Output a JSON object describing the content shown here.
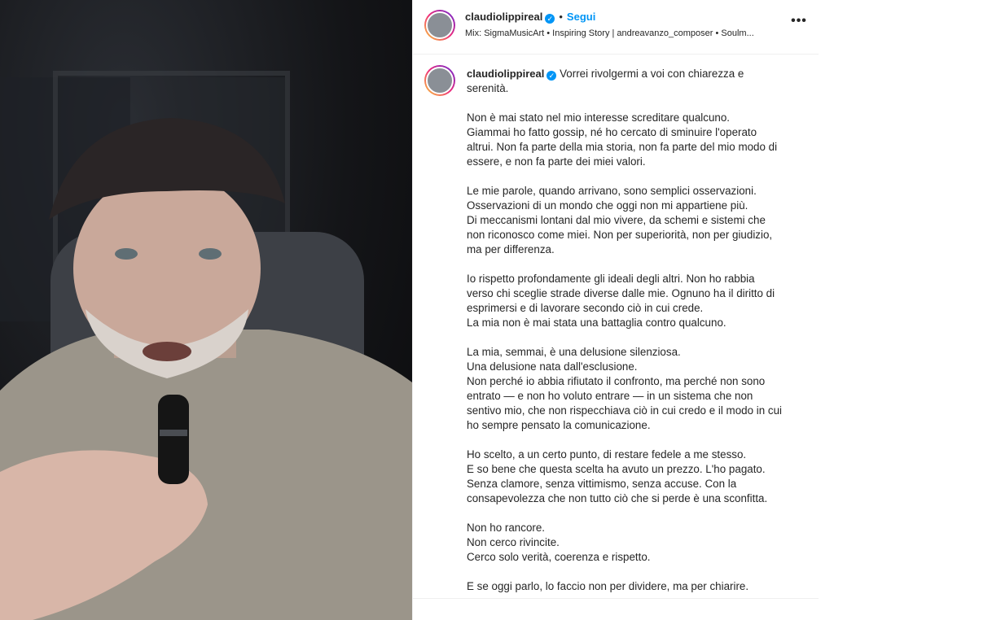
{
  "post": {
    "username": "claudiolippireal",
    "verified_mark": "✓",
    "separator": "•",
    "follow_label": "Segui",
    "audio": "Mix: SigmaMusicArt • Inspiring Story | andreavanzo_composer • Soulm...",
    "more_label": "•••"
  },
  "caption": {
    "username": "claudiolippireal",
    "first": "Vorrei rivolgermi a voi con chiarezza e serenità.",
    "paragraphs": [
      "Non è mai stato nel mio interesse screditare qualcuno.\nGiammai ho fatto gossip, né ho cercato di sminuire l'operato altrui. Non fa parte della mia storia, non fa parte del mio modo di essere, e non fa parte dei miei valori.",
      "Le mie parole, quando arrivano, sono semplici osservazioni.\nOsservazioni di un mondo che oggi non mi appartiene più.\nDi meccanismi lontani dal mio vivere, da schemi e sistemi che non riconosco come miei. Non per superiorità, non per giudizio, ma per differenza.",
      "Io rispetto profondamente gli ideali degli altri. Non ho rabbia verso chi sceglie strade diverse dalle mie. Ognuno ha il diritto di esprimersi e di lavorare secondo ciò in cui crede.\nLa mia non è mai stata una battaglia contro qualcuno.",
      "La mia, semmai, è una delusione silenziosa.\nUna delusione nata dall'esclusione.\nNon perché io abbia rifiutato il confronto, ma perché non sono entrato — e non ho voluto entrare — in un sistema che non sentivo mio, che non rispecchiava ciò in cui credo e il modo in cui ho sempre pensato la comunicazione.",
      "Ho scelto, a un certo punto, di restare fedele a me stesso.\nE so bene che questa scelta ha avuto un prezzo. L'ho pagato.\nSenza clamore, senza vittimismo, senza accuse. Con la consapevolezza che non tutto ciò che si perde è una sconfitta.",
      "Non ho rancore.\nNon cerco rivincite.\nCerco solo verità, coerenza e rispetto.",
      "E se oggi parlo, lo faccio non per dividere, ma per chiarire."
    ]
  },
  "colors": {
    "accent": "#0095f6",
    "text": "#262626",
    "divider": "#efefef"
  }
}
